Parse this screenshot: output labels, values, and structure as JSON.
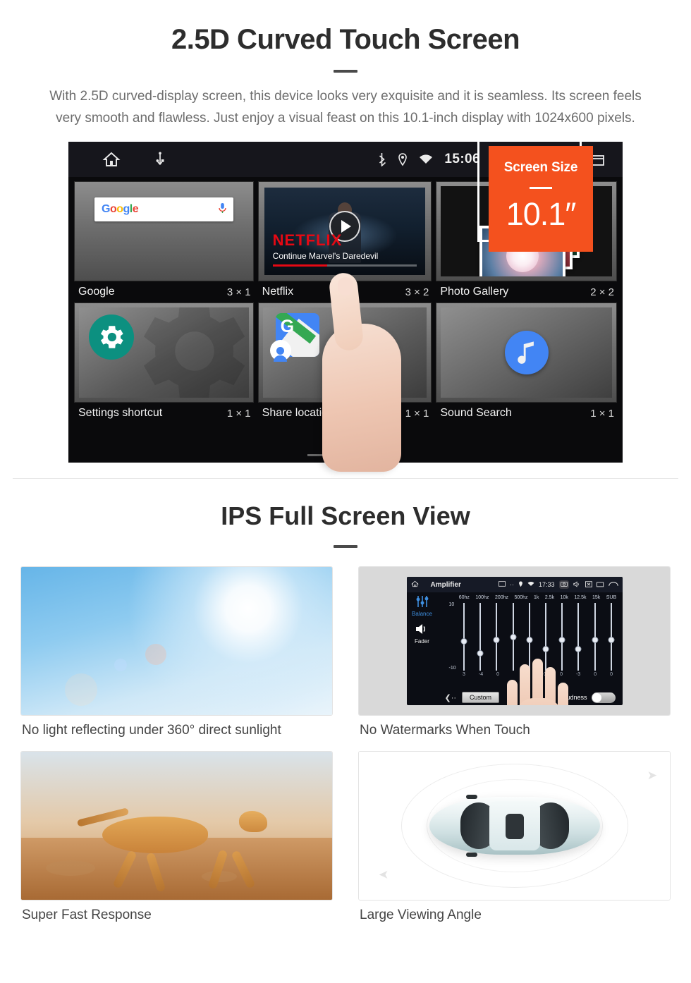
{
  "section_one": {
    "title": "2.5D Curved Touch Screen",
    "paragraph": "With 2.5D curved-display screen, this device looks very exquisite and it is seamless. Its screen feels very smooth and flawless. Just enjoy a visual feast on this 10.1-inch display with 1024x600 pixels."
  },
  "badge": {
    "label": "Screen Size",
    "value": "10.1″",
    "color": "#F4511E"
  },
  "device": {
    "statusbar": {
      "home_icon": "home-icon",
      "usb_icon": "usb-icon",
      "bluetooth_icon": "bluetooth-icon",
      "location_icon": "location-pin-icon",
      "wifi_icon": "wifi-icon",
      "time": "15:06",
      "camera_icon": "camera-icon",
      "volume_icon": "volume-icon",
      "close_icon": "close-box-icon",
      "recents_icon": "recents-icon"
    },
    "widgets_row1": [
      {
        "name": "Google",
        "size": "3 × 1",
        "icon": "google-search-widget"
      },
      {
        "name": "Netflix",
        "size": "3 × 2",
        "icon": "netflix-widget"
      },
      {
        "name": "Photo Gallery",
        "size": "2 × 2",
        "icon": "photo-gallery-widget"
      }
    ],
    "widgets_row2": [
      {
        "name": "Settings shortcut",
        "size": "1 × 1",
        "icon": "settings-gear-icon"
      },
      {
        "name": "Share location",
        "size": "1 × 1",
        "icon": "google-maps-icon"
      },
      {
        "name": "Sound Search",
        "size": "1 × 1",
        "icon": "music-note-icon"
      }
    ],
    "google_widget": {
      "wordmark": "Google",
      "mic_icon": "microphone-icon"
    },
    "netflix_widget": {
      "logo": "NETFLIX",
      "subtitle": "Continue Marvel's Daredevil",
      "play_icon": "play-icon"
    },
    "page_indicator": {
      "count": 3,
      "active": 3
    }
  },
  "section_two": {
    "title": "IPS Full Screen View",
    "cards": [
      {
        "caption": "No light reflecting under 360° direct sunlight",
        "image": "sunlight-sky-photo"
      },
      {
        "caption": "No Watermarks When Touch",
        "image": "amplifier-equalizer-screenshot"
      },
      {
        "caption": "Super Fast Response",
        "image": "running-cheetah-photo"
      },
      {
        "caption": "Large Viewing Angle",
        "image": "car-top-view-illustration"
      }
    ]
  },
  "amplifier": {
    "title": "Amplifier",
    "time": "17:33",
    "side_labels": [
      "Balance",
      "Fader"
    ],
    "bands": [
      "60hz",
      "100hz",
      "200hz",
      "500hz",
      "1k",
      "2.5k",
      "10k",
      "12.5k",
      "15k",
      "SUB"
    ],
    "values": [
      "3",
      "-4",
      "0",
      "",
      "0",
      "-3",
      "0",
      "-3",
      "0",
      "0"
    ],
    "scale_top": "10",
    "scale_bottom": "-10",
    "preset": "Custom",
    "loudness_label": "loudness",
    "loudness_on": false,
    "back_icon": "back-arrow-icon",
    "eq_icon": "equalizer-icon",
    "speaker_icon": "speaker-icon"
  }
}
